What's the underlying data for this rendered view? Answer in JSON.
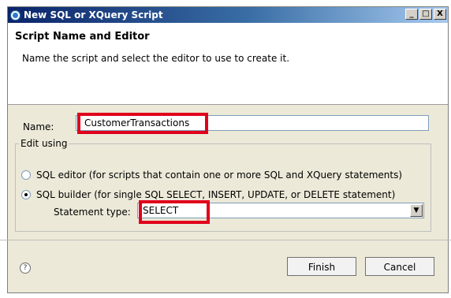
{
  "window": {
    "title": "New SQL or XQuery Script",
    "controls": {
      "minimize": "_",
      "maximize": "□",
      "close": "X"
    }
  },
  "header": {
    "title": "Script Name and Editor",
    "message": "Name the script and select the editor to use to create it."
  },
  "form": {
    "name_label": "Name:",
    "name_value": "CustomerTransactions",
    "edit_using_label": "Edit using",
    "options": [
      {
        "label": "SQL editor (for scripts that contain one or more SQL and XQuery statements)",
        "checked": false
      },
      {
        "label": "SQL builder (for single SQL SELECT, INSERT, UPDATE, or DELETE statement)",
        "checked": true
      }
    ],
    "statement_type_label": "Statement type:",
    "statement_type_value": "SELECT"
  },
  "footer": {
    "help_icon": "help-icon",
    "finish_label": "Finish",
    "cancel_label": "Cancel"
  },
  "colors": {
    "highlight": "#e0001b",
    "titlebar": "#0a246a"
  }
}
